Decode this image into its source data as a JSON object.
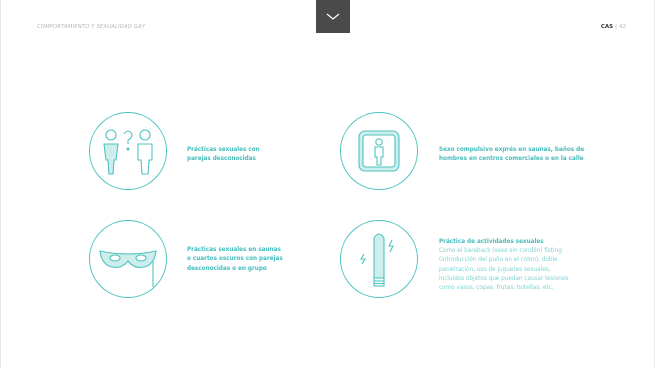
{
  "header": {
    "title": "COMPORTAMIENTO Y SEXUALIDAD GAY",
    "menu_icon": "chevron-down-icon",
    "page_code": "CAS",
    "page_separator": "|",
    "page_number": "42"
  },
  "items": [
    {
      "icon": "people-question-icon",
      "lines": [
        "Prácticas sexuales con",
        "parejas desconocidas"
      ]
    },
    {
      "icon": "person-in-booth-icon",
      "lines": [
        "Sexo compulsivo exprés en saunas, baños de",
        "hombres en centros comerciales o en la calle"
      ]
    },
    {
      "icon": "mask-icon",
      "lines": [
        "Prácticas sexuales en saunas",
        "o cuartos oscuros con parejas",
        "desconocidas o en grupo"
      ]
    },
    {
      "icon": "vibrator-icon",
      "title": "Práctica de actividades sexuales",
      "lines": [
        "Como el bareback (sexo sin condón) fisting",
        "(introducción del puño en el colon), doble",
        "penetración, uso de juguetes sexuales,",
        "incluidos objetos que puedan causar lesiones",
        "como vasos, copas, frutas, botellas, etc."
      ]
    }
  ],
  "colors": {
    "accent": "#4fc3c0",
    "fill": "#cdeeed",
    "header_tab": "#4a4a4a"
  }
}
